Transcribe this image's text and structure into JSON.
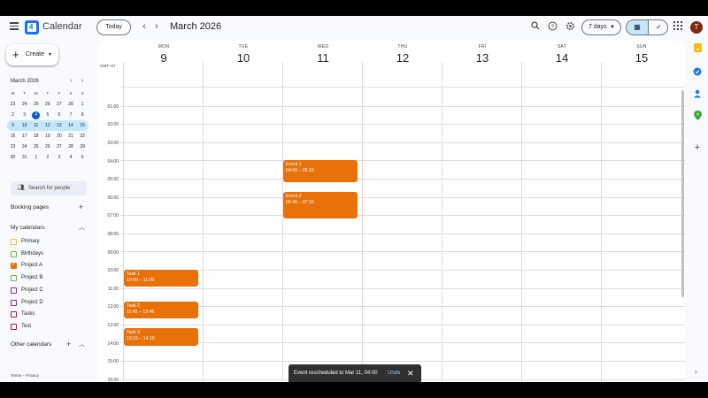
{
  "app": {
    "title": "Calendar",
    "avatar_letter": "T"
  },
  "toolbar": {
    "today_label": "Today",
    "prev": "‹",
    "next": "›",
    "month_label": "March 2026",
    "view_label": "7 days"
  },
  "sidebar": {
    "create_label": "Create",
    "mini_calendar": {
      "title": "March 2026",
      "weekday_headers": [
        "M",
        "T",
        "W",
        "T",
        "F",
        "S",
        "S"
      ],
      "weeks": [
        [
          "23",
          "24",
          "25",
          "26",
          "27",
          "28",
          "1"
        ],
        [
          "2",
          "3",
          "4",
          "5",
          "6",
          "7",
          "8"
        ],
        [
          "9",
          "10",
          "11",
          "12",
          "13",
          "14",
          "15"
        ],
        [
          "16",
          "17",
          "18",
          "19",
          "20",
          "21",
          "22"
        ],
        [
          "23",
          "24",
          "25",
          "26",
          "27",
          "28",
          "29"
        ],
        [
          "30",
          "31",
          "1",
          "2",
          "3",
          "4",
          "5"
        ]
      ],
      "today": "4",
      "highlighted_week_index": 2
    },
    "search_people_placeholder": "Search for people",
    "booking_pages_label": "Booking pages",
    "my_calendars_label": "My calendars",
    "calendars": [
      {
        "name": "Primary",
        "color": "#f6bf26",
        "checked": false
      },
      {
        "name": "Birthdays",
        "color": "#7cb342",
        "checked": false
      },
      {
        "name": "Project A",
        "color": "#e8710a",
        "checked": true
      },
      {
        "name": "Project B",
        "color": "#7cb342",
        "checked": false
      },
      {
        "name": "Project C",
        "color": "#8e24aa",
        "checked": false
      },
      {
        "name": "Project D",
        "color": "#8e24aa",
        "checked": false
      },
      {
        "name": "Tasks",
        "color": "#ad1457",
        "checked": false
      },
      {
        "name": "Test",
        "color": "#ad1457",
        "checked": false
      }
    ],
    "other_calendars_label": "Other calendars",
    "footer": "Terms – Privacy"
  },
  "grid": {
    "timezone": "GMT+07",
    "days": [
      {
        "name": "MON",
        "date": "9"
      },
      {
        "name": "TUE",
        "date": "10"
      },
      {
        "name": "WED",
        "date": "11"
      },
      {
        "name": "THU",
        "date": "12"
      },
      {
        "name": "FRI",
        "date": "13"
      },
      {
        "name": "SAT",
        "date": "14"
      },
      {
        "name": "SUN",
        "date": "15"
      }
    ],
    "hours": [
      "01:00",
      "02:00",
      "03:00",
      "04:00",
      "05:00",
      "06:00",
      "07:00",
      "08:00",
      "09:00",
      "10:00",
      "11:00",
      "12:00",
      "13:00",
      "14:00",
      "15:00",
      "16:00"
    ],
    "events": [
      {
        "title": "Event 1",
        "time": "04:00 – 05:15",
        "day": "WED",
        "start": "04:00",
        "end": "05:15",
        "color": "#e8710a"
      },
      {
        "title": "Event 2",
        "time": "05:45 – 07:15",
        "day": "WED",
        "start": "05:45",
        "end": "07:15",
        "color": "#e8710a"
      },
      {
        "title": "Task 1",
        "time": "10:00 – 11:00",
        "day": "MON",
        "start": "10:00",
        "end": "11:00",
        "color": "#e8710a"
      },
      {
        "title": "Task 2",
        "time": "11:45 – 12:45",
        "day": "MON",
        "start": "11:45",
        "end": "12:45",
        "color": "#e8710a"
      },
      {
        "title": "Task 3",
        "time": "13:15 – 14:15",
        "day": "MON",
        "start": "13:15",
        "end": "14:15",
        "color": "#e8710a"
      }
    ]
  },
  "toast": {
    "message": "Event rescheduled to Mar 11, 04:00",
    "undo_label": "Undo",
    "close": "✕"
  },
  "icons": {
    "search": "search-icon",
    "help": "help-icon",
    "settings": "gear-icon",
    "apps": "apps-grid-icon"
  }
}
